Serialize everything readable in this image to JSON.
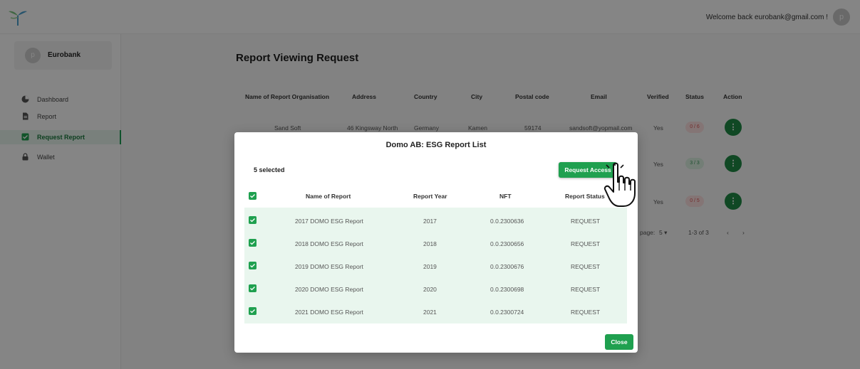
{
  "header": {
    "welcome_text": "Welcome back eurobank@gmail.com !",
    "avatar_letter": "p"
  },
  "sidebar": {
    "profile_letter": "p",
    "profile_name": "Eurobank",
    "items": [
      {
        "label": "Dashboard",
        "icon": "pie-chart-icon",
        "active": false
      },
      {
        "label": "Report",
        "icon": "document-icon",
        "active": false
      },
      {
        "label": "Request Report",
        "icon": "checkbox-icon",
        "active": true
      },
      {
        "label": "Wallet",
        "icon": "lock-icon",
        "active": false
      }
    ]
  },
  "main": {
    "title": "Report Viewing Request",
    "columns": [
      "Name of Report Organisation",
      "Address",
      "Country",
      "City",
      "Postal code",
      "Email",
      "Verified",
      "Status",
      "Action"
    ],
    "rows": [
      {
        "org": "Sand Soft",
        "address": "46 Kingsway North",
        "country": "Germany",
        "city": "Kamen",
        "postal": "59174",
        "email": "sandsoft@yopmail.com",
        "verified": "Yes",
        "status": "0 / 6",
        "status_color": "red"
      },
      {
        "verified": "Yes",
        "status": "3 / 3",
        "status_color": "green"
      },
      {
        "verified": "Yes",
        "status": "0 / 5",
        "status_color": "red"
      }
    ],
    "pagination": {
      "rows_label": "page:",
      "rows_value": "5",
      "range": "1-3 of 3"
    }
  },
  "modal": {
    "title": "Domo AB: ESG Report List",
    "selected_text": "5 selected",
    "request_button": "Request Access",
    "columns": [
      "Name of Report",
      "Report Year",
      "NFT",
      "Report Status"
    ],
    "rows": [
      {
        "name": "2017 DOMO ESG Report",
        "year": "2017",
        "nft": "0.0.2300636",
        "status": "REQUEST"
      },
      {
        "name": "2018 DOMO ESG Report",
        "year": "2018",
        "nft": "0.0.2300656",
        "status": "REQUEST"
      },
      {
        "name": "2019 DOMO ESG Report",
        "year": "2019",
        "nft": "0.0.2300676",
        "status": "REQUEST"
      },
      {
        "name": "2020 DOMO ESG Report",
        "year": "2020",
        "nft": "0.0.2300698",
        "status": "REQUEST"
      },
      {
        "name": "2021 DOMO ESG Report",
        "year": "2021",
        "nft": "0.0.2300724",
        "status": "REQUEST"
      }
    ],
    "close_button": "Close"
  },
  "colors": {
    "accent": "#1fa04f",
    "action_green": "#1f8a45",
    "row_tint": "#e9f6ee",
    "overlay": "rgba(0,0,0,0.48)"
  }
}
